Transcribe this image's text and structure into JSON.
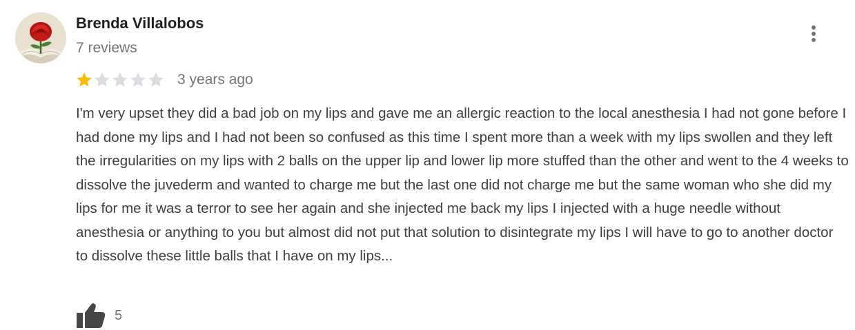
{
  "review": {
    "author": {
      "name": "Brenda Villalobos",
      "review_count": "7 reviews",
      "avatar": "rose-avatar-icon"
    },
    "rating": {
      "value": 1,
      "max": 5,
      "filled_color": "#fbbc04",
      "empty_color": "#dadce0"
    },
    "date": "3 years ago",
    "text": "I'm very upset they did a bad job on my lips and gave me an allergic reaction to the local anesthesia I had not gone before I had done my lips and I had not been so confused as this time I spent more than a week with my lips swollen and they left the irregularities on my lips with 2 balls on the upper lip and lower lip more stuffed than the other and went to the 4 weeks to dissolve the juvederm and wanted to charge me but the last one did not charge me but the same woman who she did my lips for me it was a terror to see her again and she injected me back my lips I injected with a huge needle without anesthesia or anything to you but almost did not put that solution to disintegrate my lips I will have to go to another doctor to dissolve these little balls that I have on my lips...",
    "likes": "5",
    "icons": {
      "more": "more-vert-icon",
      "like": "thumbs-up-icon"
    }
  }
}
